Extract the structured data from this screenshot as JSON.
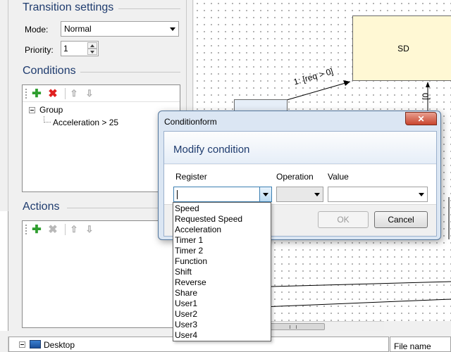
{
  "transition": {
    "title": "Transition settings",
    "mode_label": "Mode:",
    "mode_value": "Normal",
    "priority_label": "Priority:",
    "priority_value": "1"
  },
  "conditions": {
    "title": "Conditions",
    "tree": {
      "group_label": "Group",
      "child_label": "Acceleration > 25"
    }
  },
  "actions": {
    "title": "Actions"
  },
  "diagram": {
    "state_label": "SD",
    "transition_label": "1: [req > 0]",
    "side_label": "[0"
  },
  "bottom": {
    "desktop_label": "Desktop",
    "file_name_header": "File name"
  },
  "dialog": {
    "window_title": "Conditionform",
    "heading": "Modify condition",
    "register_label": "Register",
    "operation_label": "Operation",
    "value_label": "Value",
    "register_value": "",
    "ok_label": "OK",
    "cancel_label": "Cancel",
    "close_glyph": "✕"
  },
  "register_options": [
    "Speed",
    "Requested Speed",
    "Acceleration",
    "Timer 1",
    "Timer 2",
    "Function",
    "Shift",
    "Reverse",
    "Share",
    "User1",
    "User2",
    "User3",
    "User4"
  ]
}
